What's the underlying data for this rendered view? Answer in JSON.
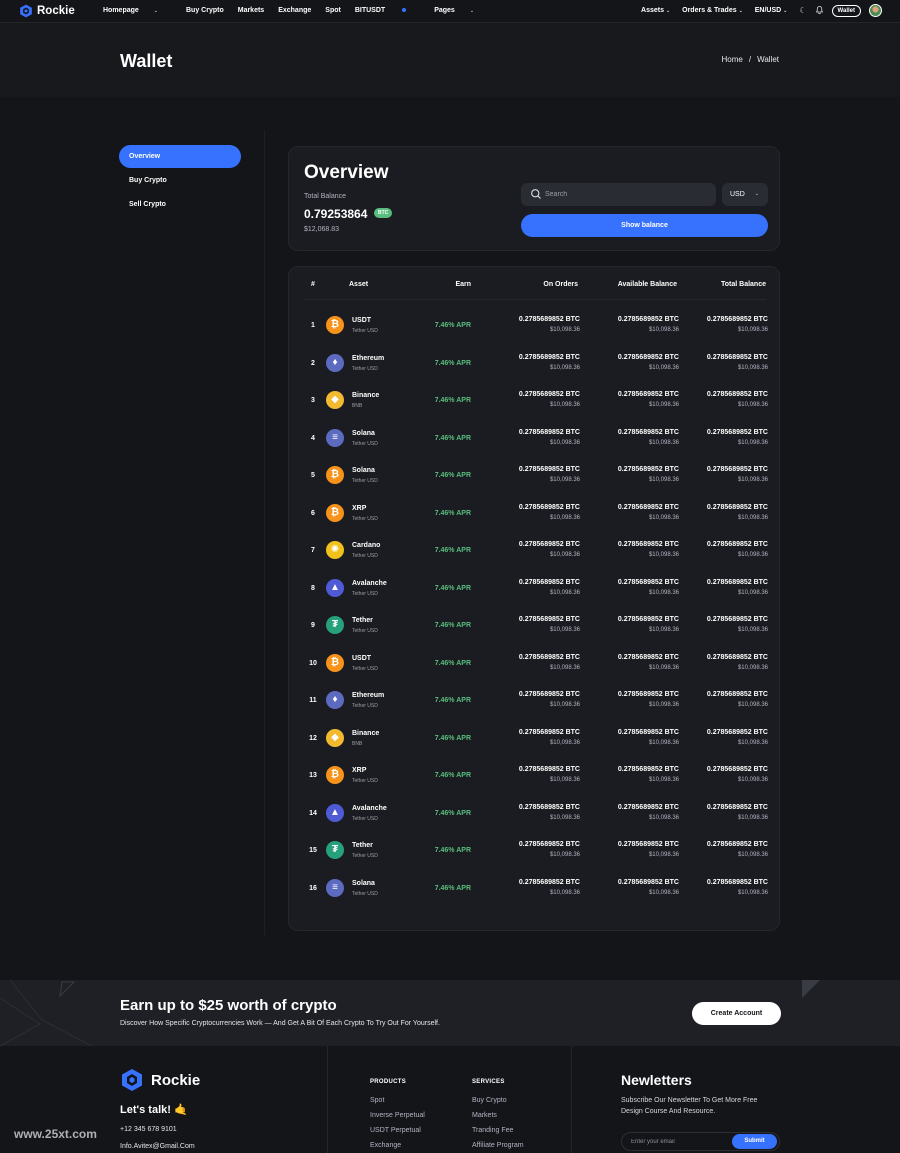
{
  "brand": {
    "name": "Rockie"
  },
  "nav": {
    "items": [
      "Homepage",
      "Buy Crypto",
      "Markets",
      "Exchange",
      "Spot",
      "BITUSDT",
      "Pages"
    ],
    "right": [
      "Assets",
      "Orders & Trades",
      "EN/USD"
    ],
    "wallet_label": "Wallet"
  },
  "page": {
    "title": "Wallet",
    "breadcrumb": [
      "Home",
      "/",
      "Wallet"
    ]
  },
  "sidebar": {
    "items": [
      "Overview",
      "Buy Crypto",
      "Sell Crypto"
    ]
  },
  "overview": {
    "title": "Overview",
    "total_label": "Total Balance",
    "amount": "0.79253864",
    "badge": "BTC",
    "usd": "$12,068.83",
    "search_placeholder": "Search",
    "currency": "USD",
    "show_balance": "Show balance"
  },
  "table": {
    "headers": [
      "#",
      "Asset",
      "Earn",
      "On Orders",
      "Available Balance",
      "Total Balance"
    ],
    "rows": [
      {
        "n": "1",
        "name": "USDT",
        "sub": "Tether USD",
        "icon": "bitcoin-icon",
        "earn": "7.46% APR",
        "btc": "0.2785689852 BTC",
        "usd": "$10,098.36"
      },
      {
        "n": "2",
        "name": "Ethereum",
        "sub": "Tether USD",
        "icon": "ethereum-icon",
        "earn": "7.46% APR",
        "btc": "0.2785689852 BTC",
        "usd": "$10,098.36"
      },
      {
        "n": "3",
        "name": "Binance",
        "sub": "BNB",
        "icon": "binance-icon",
        "earn": "7.46% APR",
        "btc": "0.2785689852 BTC",
        "usd": "$10,098.36"
      },
      {
        "n": "4",
        "name": "Solana",
        "sub": "Tether USD",
        "icon": "solana-icon",
        "earn": "7.46% APR",
        "btc": "0.2785689852 BTC",
        "usd": "$10,098.36"
      },
      {
        "n": "5",
        "name": "Solana",
        "sub": "Tether USD",
        "icon": "bitcoin-icon",
        "earn": "7.46% APR",
        "btc": "0.2785689852 BTC",
        "usd": "$10,098.36"
      },
      {
        "n": "6",
        "name": "XRP",
        "sub": "Tether USD",
        "icon": "bitcoin-icon",
        "earn": "7.46% APR",
        "btc": "0.2785689852 BTC",
        "usd": "$10,098.36"
      },
      {
        "n": "7",
        "name": "Cardano",
        "sub": "Tether USD",
        "icon": "cardano-icon",
        "earn": "7.46% APR",
        "btc": "0.2785689852 BTC",
        "usd": "$10,098.36"
      },
      {
        "n": "8",
        "name": "Avalanche",
        "sub": "Tether USD",
        "icon": "avalanche-icon",
        "earn": "7.46% APR",
        "btc": "0.2785689852 BTC",
        "usd": "$10,098.36"
      },
      {
        "n": "9",
        "name": "Tether",
        "sub": "Tether USD",
        "icon": "tether-icon",
        "earn": "7.46% APR",
        "btc": "0.2785689852 BTC",
        "usd": "$10,098.36"
      },
      {
        "n": "10",
        "name": "USDT",
        "sub": "Tether USD",
        "icon": "bitcoin-icon",
        "earn": "7.46% APR",
        "btc": "0.2785689852 BTC",
        "usd": "$10,098.36"
      },
      {
        "n": "11",
        "name": "Ethereum",
        "sub": "Tether USD",
        "icon": "ethereum-icon",
        "earn": "7.46% APR",
        "btc": "0.2785689852 BTC",
        "usd": "$10,098.36"
      },
      {
        "n": "12",
        "name": "Binance",
        "sub": "BNB",
        "icon": "binance-icon",
        "earn": "7.46% APR",
        "btc": "0.2785689852 BTC",
        "usd": "$10,098.36"
      },
      {
        "n": "13",
        "name": "XRP",
        "sub": "Tether USD",
        "icon": "bitcoin-icon",
        "earn": "7.46% APR",
        "btc": "0.2785689852 BTC",
        "usd": "$10,098.36"
      },
      {
        "n": "14",
        "name": "Avalanche",
        "sub": "Tether USD",
        "icon": "avalanche-icon",
        "earn": "7.46% APR",
        "btc": "0.2785689852 BTC",
        "usd": "$10,098.36"
      },
      {
        "n": "15",
        "name": "Tether",
        "sub": "Tether USD",
        "icon": "tether-icon",
        "earn": "7.46% APR",
        "btc": "0.2785689852 BTC",
        "usd": "$10,098.36"
      },
      {
        "n": "16",
        "name": "Solana",
        "sub": "Tether USD",
        "icon": "solana-icon",
        "earn": "7.46% APR",
        "btc": "0.2785689852 BTC",
        "usd": "$10,098.36"
      }
    ]
  },
  "cta": {
    "title": "Earn up to $25 worth of crypto",
    "text": "Discover How Specific Cryptocurrencies Work — And Get A Bit Of Each Crypto To Try Out For Yourself.",
    "button": "Create Account"
  },
  "footer": {
    "talk": "Let's talk! 🤙",
    "phone": "+12 345 678 9101",
    "email": "Info.Avitex@Gmail.Com",
    "products_title": "PRODUCTS",
    "products": [
      "Spot",
      "Inverse Perpetual",
      "USDT Perpetual",
      "Exchange"
    ],
    "services_title": "SERVICES",
    "services": [
      "Buy Crypto",
      "Markets",
      "Tranding Fee",
      "Affiliate Program"
    ],
    "newsletter_title": "Newletters",
    "newsletter_text": "Subscribe Our Newsletter To Get More Free Design Course And Resource.",
    "email_placeholder": "Enter your email",
    "submit": "Submit"
  },
  "watermark": "www.25xt.com",
  "colors": {
    "accent": "#3772ff",
    "positive": "#58bd7d",
    "background": "#141519",
    "card": "#1b1c21"
  }
}
